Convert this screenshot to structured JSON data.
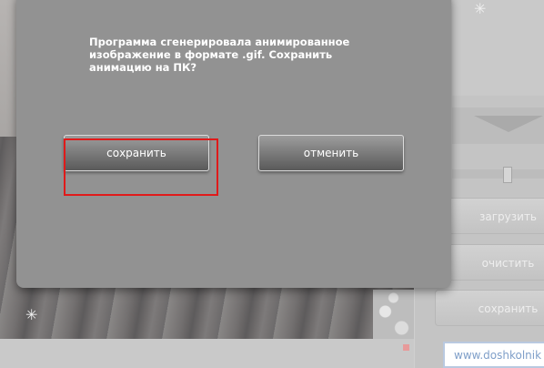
{
  "dialog": {
    "message": "Программа сгенерировала анимированное изображение в формате .gif. Сохранить анимацию на ПК?",
    "save_label": "сохранить",
    "cancel_label": "отменить"
  },
  "side_panel": {
    "load_label": "загрузить",
    "clear_label": "очистить",
    "save_label": "сохранить"
  },
  "url_box": {
    "text": "www.doshkolnik"
  },
  "colors": {
    "dialog_bg": "#929292",
    "highlight": "#e01a1a"
  }
}
